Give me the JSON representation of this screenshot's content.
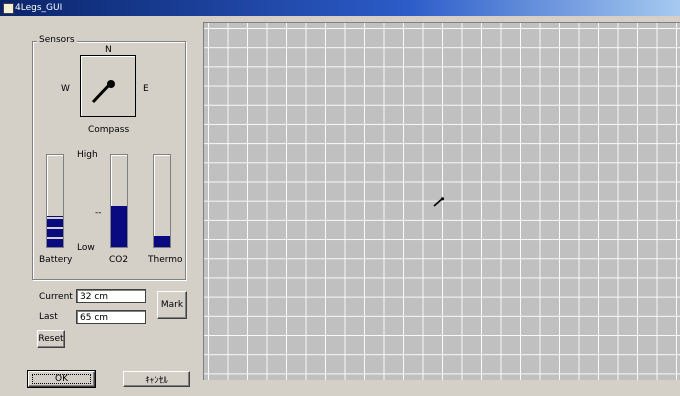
{
  "window": {
    "title": "4Legs_GUI"
  },
  "sensors": {
    "group_label": "Sensors",
    "compass": {
      "north": "N",
      "south": "",
      "west": "W",
      "east": "E",
      "label": "Compass",
      "needle_icon": "compass-needle-icon"
    },
    "scale": {
      "high": "High",
      "mid": "--",
      "low": "Low"
    },
    "meters": [
      {
        "label": "Battery",
        "level": 0.34,
        "color": "#0a0a80"
      },
      {
        "label": "CO2",
        "level": 0.45,
        "color": "#0a0a80"
      },
      {
        "label": "Thermo",
        "level": 0.12,
        "color": "#0a0a80"
      }
    ]
  },
  "distance": {
    "current_label": "Current",
    "current_value": "32 cm",
    "last_label": "Last",
    "last_value": "65 cm"
  },
  "buttons": {
    "mark": "Mark",
    "reset": "Reset",
    "ok": "OK",
    "cancel": "ｷｬﾝｾﾙ"
  },
  "map": {
    "marker_icon": "robot-heading-icon"
  }
}
